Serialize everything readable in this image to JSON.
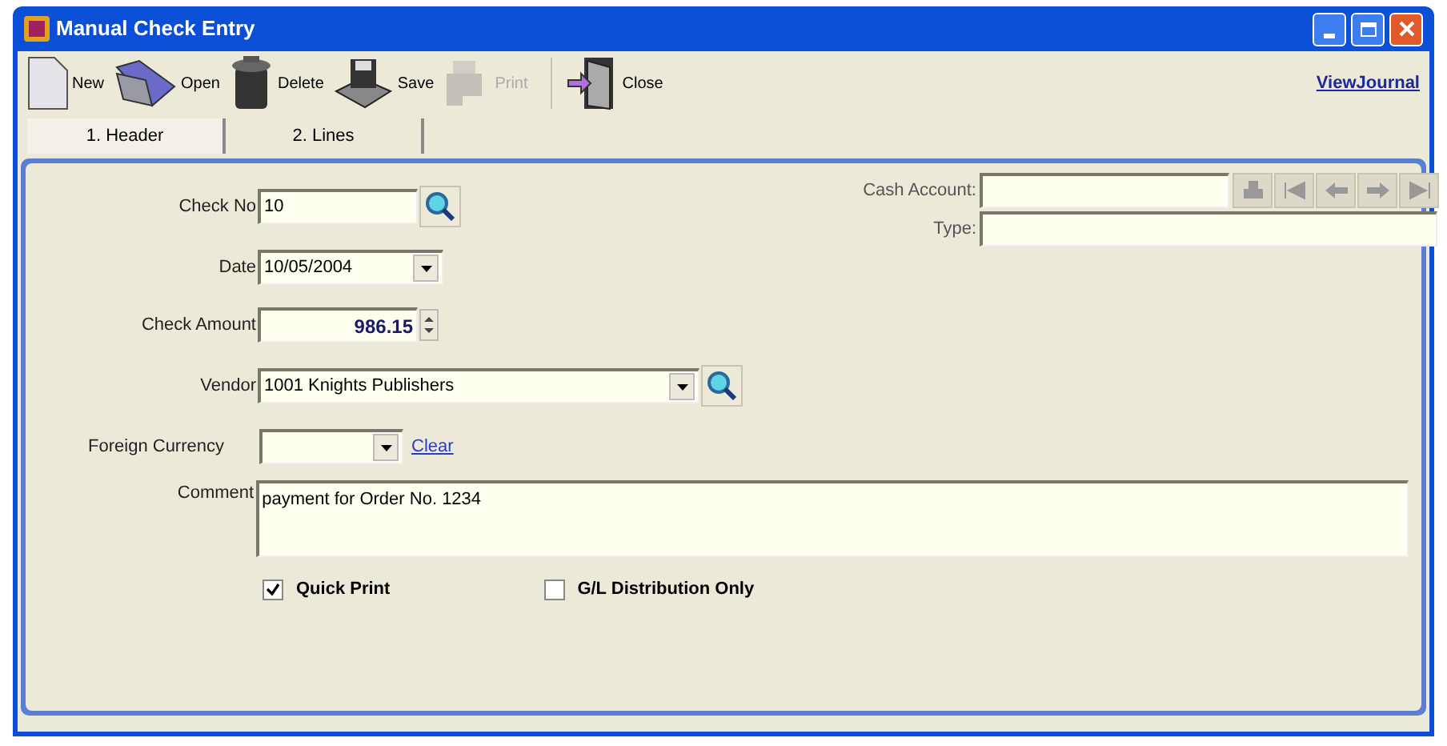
{
  "window": {
    "title": "Manual Check Entry"
  },
  "toolbar": [
    {
      "kind": "new",
      "label": "New",
      "disabled": false
    },
    {
      "kind": "open",
      "label": "Open",
      "disabled": false
    },
    {
      "kind": "delete",
      "label": "Delete",
      "disabled": false
    },
    {
      "kind": "save",
      "label": "Save",
      "disabled": false
    },
    {
      "kind": "print",
      "label": "Print",
      "disabled": true
    },
    {
      "kind": "close",
      "label": "Close",
      "disabled": false
    }
  ],
  "journal_link": "ViewJournal",
  "tabs": [
    {
      "label": "1. Header",
      "selected": true
    },
    {
      "label": "2. Lines",
      "selected": false
    }
  ],
  "form": {
    "check_no": {
      "label": "Check No",
      "value": "10"
    },
    "date": {
      "label": "Date",
      "value": "10/05/2004"
    },
    "check_amount": {
      "label": "Check Amount",
      "value": "986.15"
    },
    "vendor": {
      "label": "Vendor",
      "value": "1001 Knights Publishers"
    },
    "foreign_currency": {
      "label": "Foreign Currency",
      "link": "Clear"
    },
    "cash_account": {
      "label": "Cash Account:"
    },
    "type": {
      "label": "Type:"
    },
    "comment": {
      "label": "Comment",
      "value": "payment for Order No. 1234"
    }
  },
  "checkboxes": [
    {
      "label": "Quick Print",
      "checked": true
    },
    {
      "label": "G/L Distribution Only",
      "checked": false
    }
  ]
}
